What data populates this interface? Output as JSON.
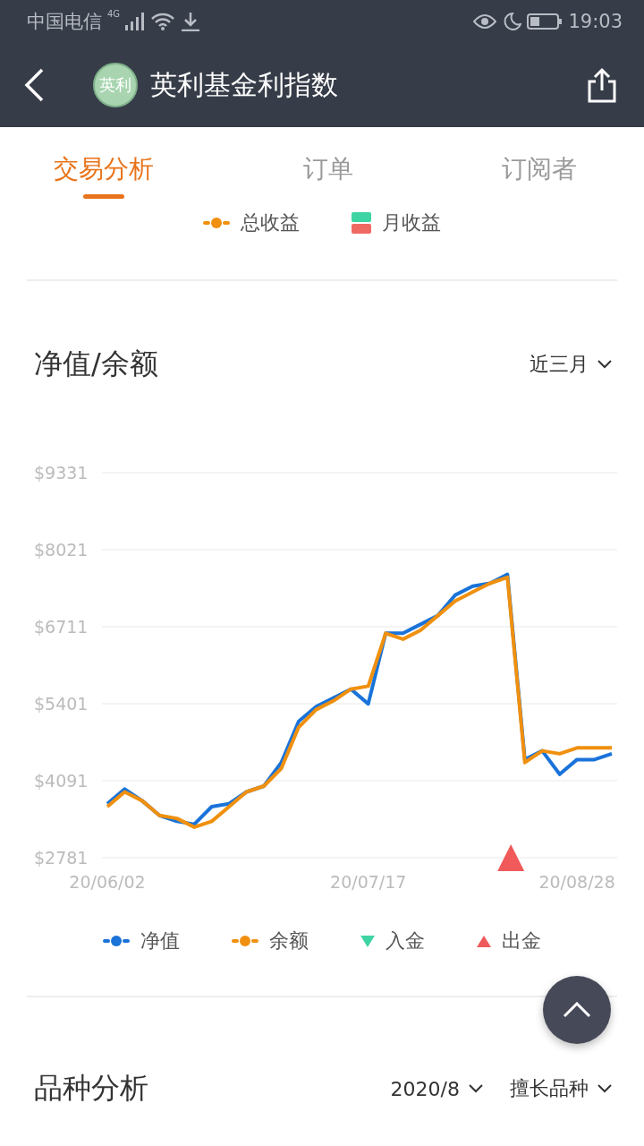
{
  "status_bar": {
    "carrier": "中国电信",
    "network": "4G",
    "time": "19:03"
  },
  "header": {
    "avatar_text": "英利",
    "title": "英利基金利指数"
  },
  "tabs": [
    {
      "label": "交易分析",
      "selected": true
    },
    {
      "label": "订单",
      "selected": false
    },
    {
      "label": "订阅者",
      "selected": false
    }
  ],
  "top_legend": [
    {
      "kind": "line",
      "label": "总收益",
      "color": "#f0900f"
    },
    {
      "kind": "split",
      "label": "月收益",
      "color": "#3ed3a3"
    }
  ],
  "net_value_section": {
    "title": "净值/余额",
    "range": "近三月",
    "chart_data": {
      "type": "line",
      "categories": [
        "20/06/02",
        null,
        null,
        null,
        null,
        null,
        null,
        null,
        null,
        null,
        null,
        null,
        null,
        null,
        null,
        "20/07/17",
        null,
        null,
        null,
        null,
        null,
        null,
        null,
        null,
        null,
        null,
        null,
        "20/08/28",
        null,
        null
      ],
      "ylim": [
        2781,
        9331
      ],
      "grid": true,
      "yticks": [
        {
          "value": 2781,
          "label": "$2781"
        },
        {
          "value": 4091,
          "label": "$4091"
        },
        {
          "value": 5401,
          "label": "$5401"
        },
        {
          "value": 6711,
          "label": "$6711"
        },
        {
          "value": 8021,
          "label": "$8021"
        },
        {
          "value": 9331,
          "label": "$9331"
        }
      ],
      "series": [
        {
          "name": "净值",
          "color": "#1a73d9",
          "values": [
            3700,
            3950,
            3750,
            3500,
            3400,
            3350,
            3650,
            3700,
            3900,
            4000,
            4400,
            5100,
            5350,
            5500,
            5650,
            5400,
            6600,
            6600,
            6750,
            6900,
            7250,
            7400,
            7450,
            7600,
            4450,
            4600,
            4200,
            4450,
            4450,
            4550
          ]
        },
        {
          "name": "余额",
          "color": "#f0900f",
          "values": [
            3650,
            3900,
            3750,
            3500,
            3450,
            3300,
            3400,
            3650,
            3900,
            4000,
            4300,
            5000,
            5300,
            5450,
            5650,
            5700,
            6600,
            6500,
            6650,
            6900,
            7150,
            7300,
            7450,
            7550,
            4400,
            4600,
            4550,
            4650,
            4650,
            4650
          ]
        }
      ]
    },
    "markers_legend": [
      {
        "kind": "down",
        "label": "入金",
        "color": "#3ed3a3"
      },
      {
        "kind": "up",
        "label": "出金",
        "color": "#f05a5a"
      }
    ]
  },
  "variety_section": {
    "title": "品种分析",
    "month": "2020/8",
    "filter": "擅长品种"
  }
}
